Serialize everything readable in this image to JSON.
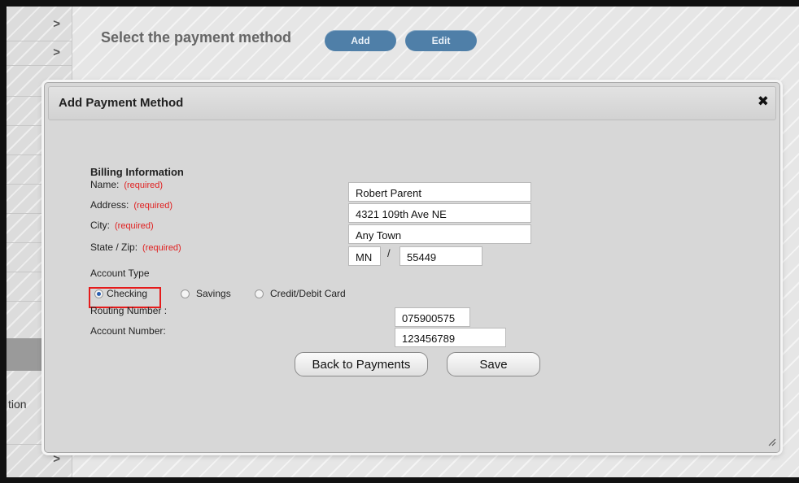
{
  "background": {
    "title": "Select the payment method",
    "add_label": "Add",
    "edit_label": "Edit",
    "sidebar_fragment": "tion",
    "chevron_glyph": ">"
  },
  "dialog": {
    "title": "Add Payment Method",
    "close_glyph": "✖",
    "section_heading": "Billing Information",
    "required_text": "(required)",
    "fields": {
      "name_label": "Name:",
      "name_value": "Robert Parent",
      "address_label": "Address:",
      "address_value": "4321 109th Ave NE",
      "city_label": "City:",
      "city_value": "Any Town",
      "statezip_label": "State / Zip:",
      "state_value": "MN",
      "zip_separator": "/",
      "zip_value": "55449"
    },
    "account_type_label": "Account Type",
    "account_types": {
      "checking": "Checking",
      "savings": "Savings",
      "card": "Credit/Debit Card",
      "selected": "Checking"
    },
    "routing_label": "Routing Number :",
    "routing_value": "075900575",
    "account_label": "Account Number:",
    "account_value": "123456789",
    "back_label": "Back to Payments",
    "save_label": "Save"
  },
  "colors": {
    "pill": "#4f7fa8",
    "required": "#e02020",
    "highlight": "#e51b1b"
  }
}
